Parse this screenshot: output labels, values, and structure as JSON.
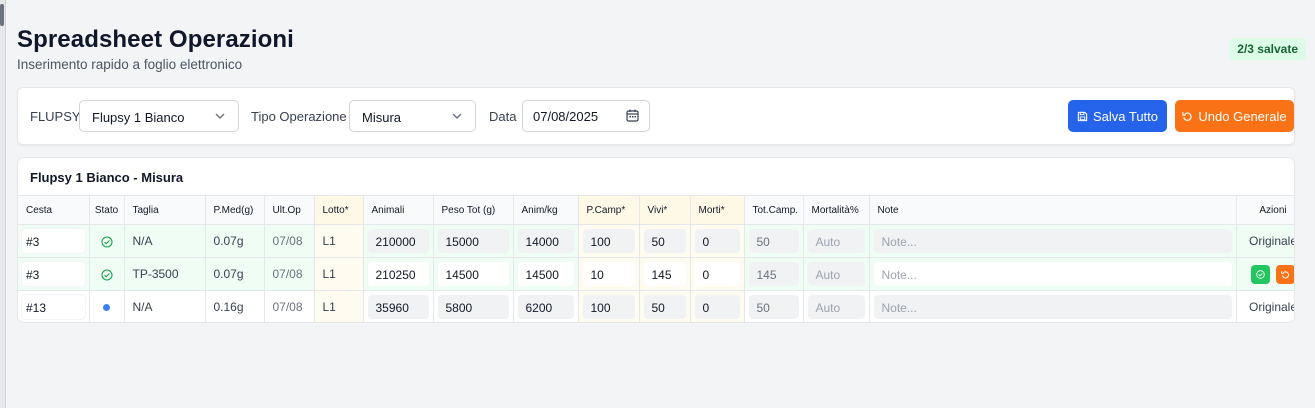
{
  "page": {
    "title": "Spreadsheet Operazioni",
    "subtitle": "Inserimento rapido a foglio elettronico",
    "saved_badge": "2/3 salvate"
  },
  "toolbar": {
    "flupsy_label": "FLUPSY",
    "flupsy_value": "Flupsy 1 Bianco",
    "tipo_label": "Tipo Operazione",
    "tipo_value": "Misura",
    "data_label": "Data",
    "data_value": "07/08/2025",
    "save_all_label": "Salva Tutto",
    "undo_all_label": "Undo Generale"
  },
  "grid": {
    "title": "Flupsy 1 Bianco - Misura",
    "columns": [
      "Cesta",
      "Stato",
      "Taglia",
      "P.Med(g)",
      "Ult.Op",
      "Lotto*",
      "Animali",
      "Peso Tot (g)",
      "Anim/kg",
      "P.Camp*",
      "Vivi*",
      "Morti*",
      "Tot.Camp.",
      "Mortalità%",
      "Note",
      "Azioni"
    ],
    "rows": [
      {
        "cesta": "#3",
        "stato": "saved",
        "taglia": "N/A",
        "pmed": "0.07g",
        "ultop": "07/08",
        "lotto": "L1",
        "animali": "210000",
        "peso": "15000",
        "animkg": "14000",
        "pcamp": "100",
        "vivi": "50",
        "morti": "0",
        "totcamp": "50",
        "mortalita": "Auto",
        "note_placeholder": "Note...",
        "azioni": "Originale"
      },
      {
        "cesta": "#3",
        "stato": "saved",
        "taglia": "TP-3500",
        "pmed": "0.07g",
        "ultop": "07/08",
        "lotto": "L1",
        "animali": "210250",
        "peso": "14500",
        "animkg": "14500",
        "pcamp": "10",
        "vivi": "145",
        "morti": "0",
        "totcamp": "145",
        "mortalita": "Auto",
        "note_placeholder": "Note...",
        "azioni": ""
      },
      {
        "cesta": "#13",
        "stato": "pending",
        "taglia": "N/A",
        "pmed": "0.16g",
        "ultop": "07/08",
        "lotto": "L1",
        "animali": "35960",
        "peso": "5800",
        "animkg": "6200",
        "pcamp": "100",
        "vivi": "50",
        "morti": "0",
        "totcamp": "50",
        "mortalita": "Auto",
        "note_placeholder": "Note...",
        "azioni": "Originale"
      }
    ]
  },
  "colors": {
    "primary_blue": "#2563eb",
    "warning_orange": "#f97316",
    "success_green": "#22c55e",
    "saved_row_bg": "#f0fdf4",
    "pending_dot": "#3b82f6"
  },
  "icons": {
    "flupsy_select": "chevron-down-icon",
    "tipo_select": "chevron-down-icon",
    "date": "calendar-icon",
    "save_all": "save-icon",
    "undo_all": "undo-icon",
    "saved_status": "check-circle-icon",
    "pending_status": "dot-icon",
    "row_save": "check-circle-icon",
    "row_undo": "undo-icon"
  }
}
